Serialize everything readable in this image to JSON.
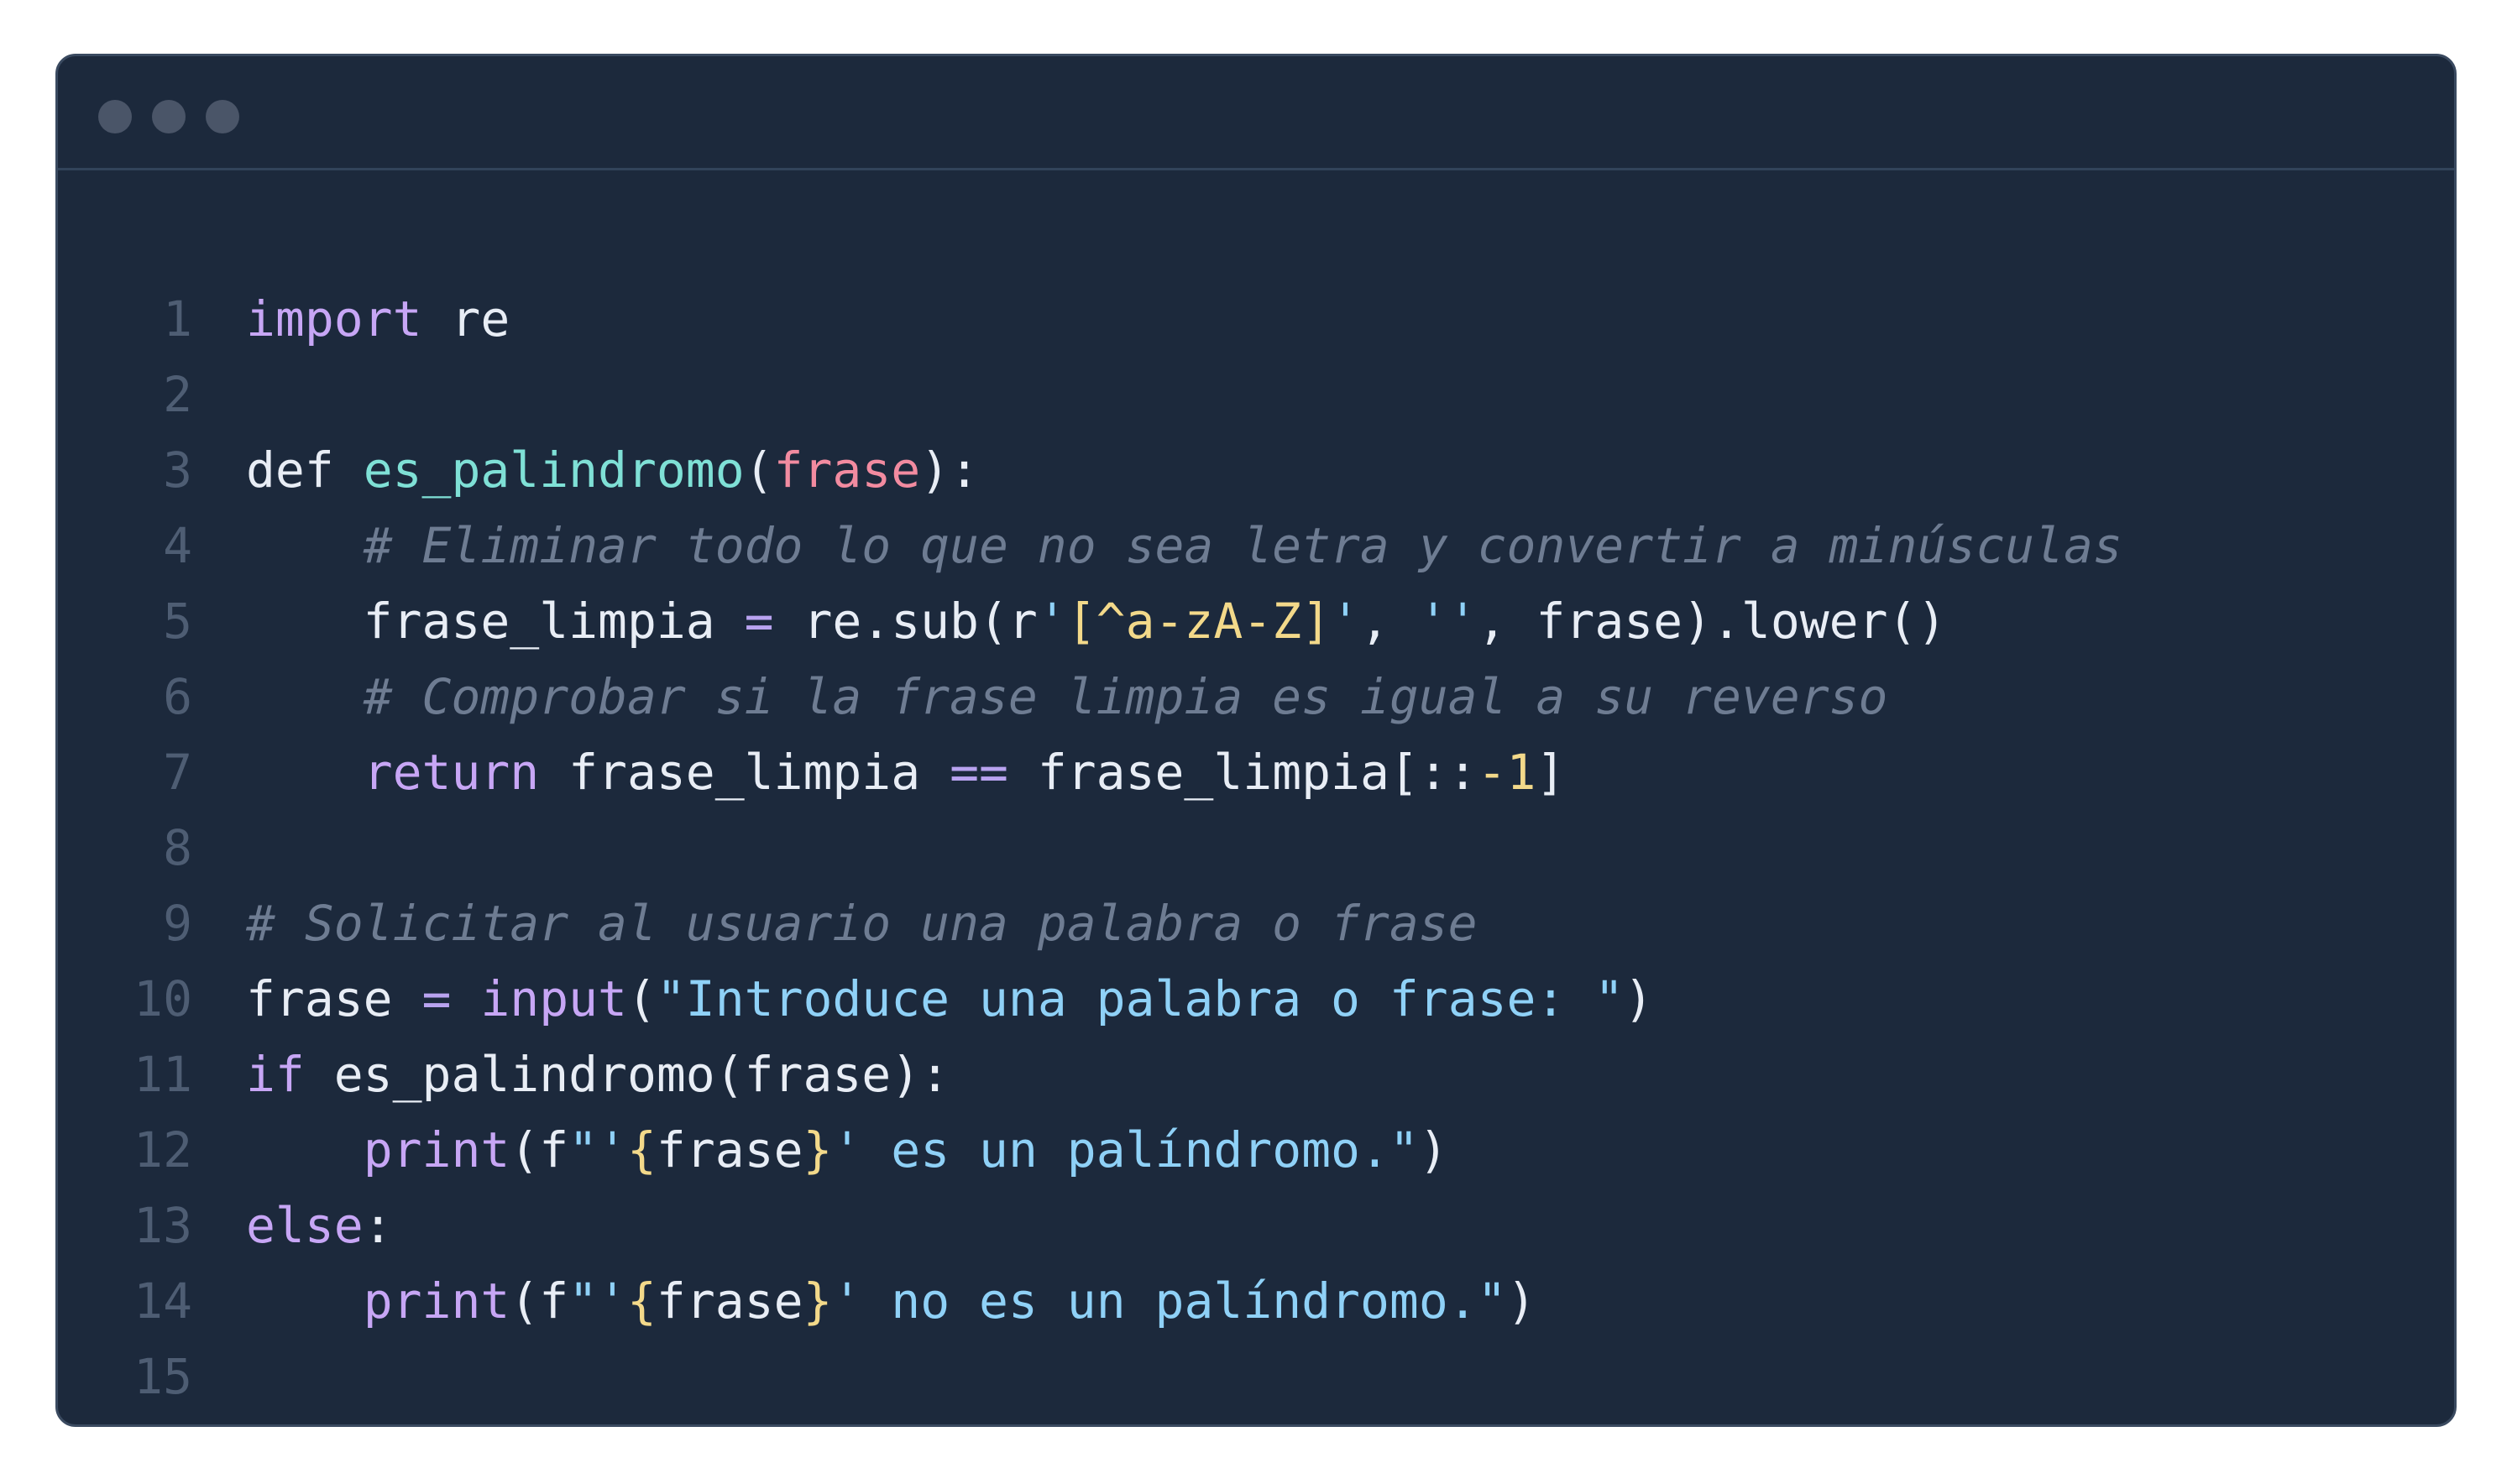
{
  "window": {
    "title_dots": [
      "close",
      "minimize",
      "maximize"
    ]
  },
  "code": {
    "language": "python",
    "lines": [
      {
        "n": "1",
        "tokens": [
          {
            "t": "import",
            "c": "kw"
          },
          {
            "t": " re",
            "c": "pl"
          }
        ]
      },
      {
        "n": "2",
        "tokens": []
      },
      {
        "n": "3",
        "tokens": [
          {
            "t": "def",
            "c": "pl"
          },
          {
            "t": " ",
            "c": "pl"
          },
          {
            "t": "es_palindromo",
            "c": "fn"
          },
          {
            "t": "(",
            "c": "pl"
          },
          {
            "t": "frase",
            "c": "param"
          },
          {
            "t": "):",
            "c": "pl"
          }
        ]
      },
      {
        "n": "4",
        "tokens": [
          {
            "t": "    # Eliminar todo lo que no sea letra y convertir a minúsculas",
            "c": "cm"
          }
        ]
      },
      {
        "n": "5",
        "tokens": [
          {
            "t": "    frase_limpia ",
            "c": "pl"
          },
          {
            "t": "=",
            "c": "op"
          },
          {
            "t": " re.sub(r",
            "c": "pl"
          },
          {
            "t": "'",
            "c": "str"
          },
          {
            "t": "[^a-zA-Z]",
            "c": "strq"
          },
          {
            "t": "'",
            "c": "str"
          },
          {
            "t": ", ",
            "c": "pl"
          },
          {
            "t": "''",
            "c": "str"
          },
          {
            "t": ", frase).lower()",
            "c": "pl"
          }
        ]
      },
      {
        "n": "6",
        "tokens": [
          {
            "t": "    # Comprobar si la frase limpia es igual a su reverso",
            "c": "cm"
          }
        ]
      },
      {
        "n": "7",
        "tokens": [
          {
            "t": "    ",
            "c": "pl"
          },
          {
            "t": "return",
            "c": "kw"
          },
          {
            "t": " frase_limpia ",
            "c": "pl"
          },
          {
            "t": "==",
            "c": "op"
          },
          {
            "t": " frase_limpia[::",
            "c": "pl"
          },
          {
            "t": "-1",
            "c": "num"
          },
          {
            "t": "]",
            "c": "pl"
          }
        ]
      },
      {
        "n": "8",
        "tokens": []
      },
      {
        "n": "9",
        "tokens": [
          {
            "t": "# Solicitar al usuario una palabra o frase",
            "c": "cm"
          }
        ]
      },
      {
        "n": "10",
        "tokens": [
          {
            "t": "frase ",
            "c": "pl"
          },
          {
            "t": "=",
            "c": "op"
          },
          {
            "t": " ",
            "c": "pl"
          },
          {
            "t": "input",
            "c": "kw"
          },
          {
            "t": "(",
            "c": "pl"
          },
          {
            "t": "\"Introduce una palabra o frase: \"",
            "c": "str"
          },
          {
            "t": ")",
            "c": "pl"
          }
        ]
      },
      {
        "n": "11",
        "tokens": [
          {
            "t": "if",
            "c": "kw"
          },
          {
            "t": " es_palindromo(frase):",
            "c": "pl"
          }
        ]
      },
      {
        "n": "12",
        "tokens": [
          {
            "t": "    ",
            "c": "pl"
          },
          {
            "t": "print",
            "c": "kw"
          },
          {
            "t": "(f",
            "c": "pl"
          },
          {
            "t": "\"'",
            "c": "str"
          },
          {
            "t": "{",
            "c": "br"
          },
          {
            "t": "frase",
            "c": "pl"
          },
          {
            "t": "}",
            "c": "br"
          },
          {
            "t": "' es un palíndromo.\"",
            "c": "str"
          },
          {
            "t": ")",
            "c": "pl"
          }
        ]
      },
      {
        "n": "13",
        "tokens": [
          {
            "t": "else",
            "c": "kw"
          },
          {
            "t": ":",
            "c": "pl"
          }
        ]
      },
      {
        "n": "14",
        "tokens": [
          {
            "t": "    ",
            "c": "pl"
          },
          {
            "t": "print",
            "c": "kw"
          },
          {
            "t": "(f",
            "c": "pl"
          },
          {
            "t": "\"'",
            "c": "str"
          },
          {
            "t": "{",
            "c": "br"
          },
          {
            "t": "frase",
            "c": "pl"
          },
          {
            "t": "}",
            "c": "br"
          },
          {
            "t": "' no es un palíndromo.\"",
            "c": "str"
          },
          {
            "t": ")",
            "c": "pl"
          }
        ]
      },
      {
        "n": "15",
        "tokens": []
      }
    ]
  },
  "colors": {
    "background": "#1c293c",
    "keyword": "#c7a6f5",
    "function": "#7fe0d6",
    "parameter": "#f28ba0",
    "comment": "#6e7c92",
    "string": "#8fd1f7",
    "number": "#f3d98a",
    "line_number": "#4e5d73"
  }
}
